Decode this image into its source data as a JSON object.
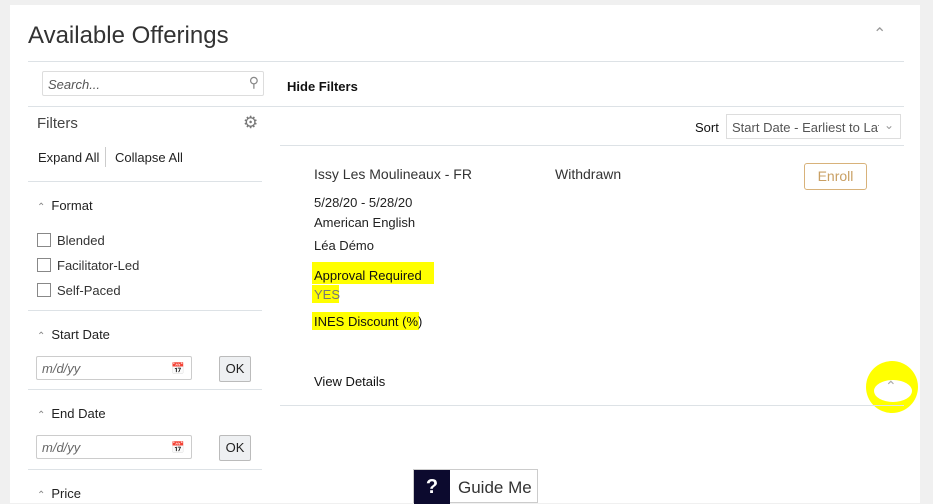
{
  "header": {
    "title": "Available Offerings"
  },
  "search": {
    "placeholder": "Search..."
  },
  "filters": {
    "title": "Filters",
    "expand_all": "Expand All",
    "collapse_all": "Collapse All",
    "format": {
      "label": "Format",
      "options": [
        "Blended",
        "Facilitator-Led",
        "Self-Paced"
      ]
    },
    "start_date": {
      "label": "Start Date",
      "placeholder": "m/d/yy",
      "ok": "OK"
    },
    "end_date": {
      "label": "End Date",
      "placeholder": "m/d/yy",
      "ok": "OK"
    },
    "price": {
      "label": "Price"
    }
  },
  "toolbar": {
    "hide_filters": "Hide Filters",
    "sort_label": "Sort",
    "sort_value": "Start Date - Earliest to Lat"
  },
  "offering": {
    "location": "Issy Les Moulineaux - FR",
    "status": "Withdrawn",
    "enroll": "Enroll",
    "dates": "5/28/20 - 5/28/20",
    "language": "American English",
    "instructor": "Léa Démo",
    "approval_label": "Approval Required",
    "approval_value": "YES",
    "discount_label": "INES Discount (%)",
    "view_details": "View Details"
  },
  "guide": {
    "icon": "?",
    "label": "Guide Me"
  }
}
